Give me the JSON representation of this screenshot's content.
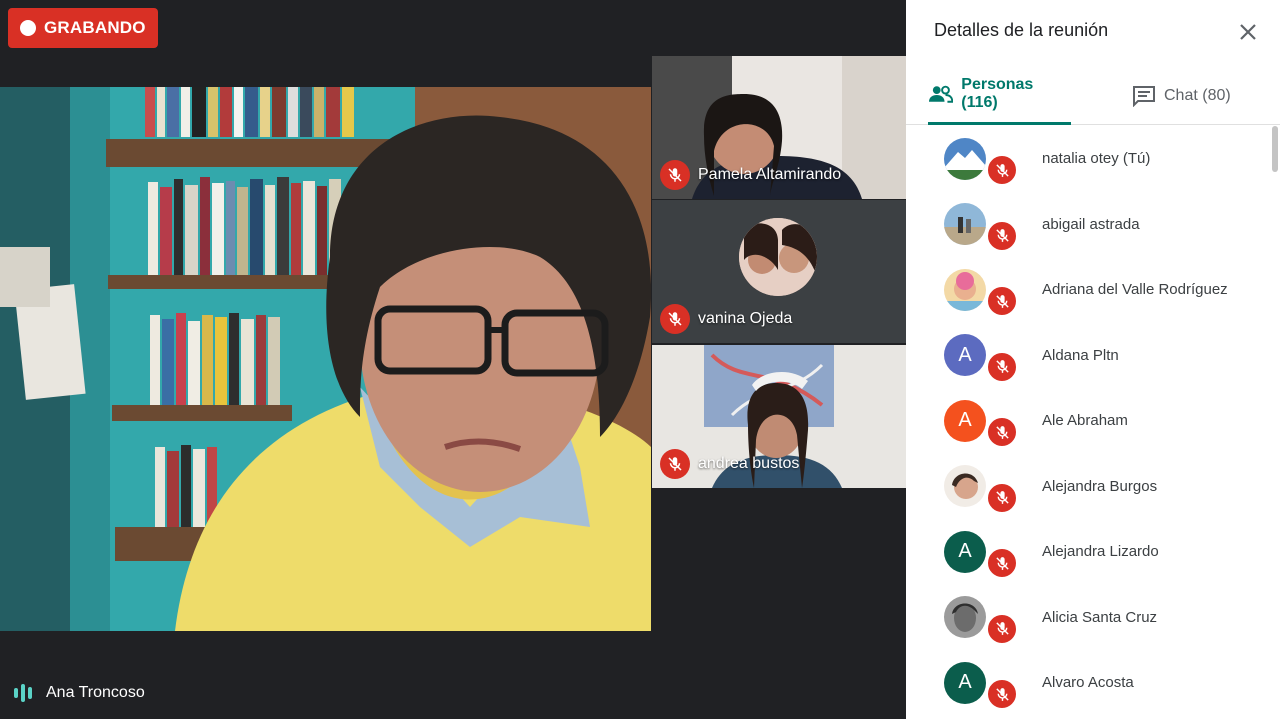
{
  "recording": {
    "label": "GRABANDO"
  },
  "main_speaker": {
    "name": "Ana Troncoso"
  },
  "tiles": [
    {
      "name": "Pamela Altamirando",
      "mic": "mic-off"
    },
    {
      "name": "vanina Ojeda",
      "mic": "mic-off"
    },
    {
      "name": "andrea bustos",
      "mic": "mic-off"
    }
  ],
  "panel": {
    "title": "Detalles de la reunión",
    "tabs": {
      "people": "Personas (116)",
      "chat": "Chat (80)"
    }
  },
  "people": [
    {
      "name": "natalia otey (Tú)",
      "avatar": "photo"
    },
    {
      "name": "abigail astrada",
      "avatar": "photo"
    },
    {
      "name": "Adriana del Valle Rodríguez",
      "avatar": "photo"
    },
    {
      "name": "Aldana Pltn",
      "avatar": "A",
      "color": "#5c6bc0"
    },
    {
      "name": "Ale Abraham",
      "avatar": "A",
      "color": "#f4511e"
    },
    {
      "name": "Alejandra Burgos",
      "avatar": "photo"
    },
    {
      "name": "Alejandra Lizardo",
      "avatar": "A",
      "color": "#0b5d4c"
    },
    {
      "name": "Alicia Santa Cruz",
      "avatar": "photo"
    },
    {
      "name": "Alvaro Acosta",
      "avatar": "A",
      "color": "#0b5d4c"
    }
  ],
  "colors": {
    "accent": "#00796b",
    "mute": "#d93025",
    "background": "#202124"
  }
}
